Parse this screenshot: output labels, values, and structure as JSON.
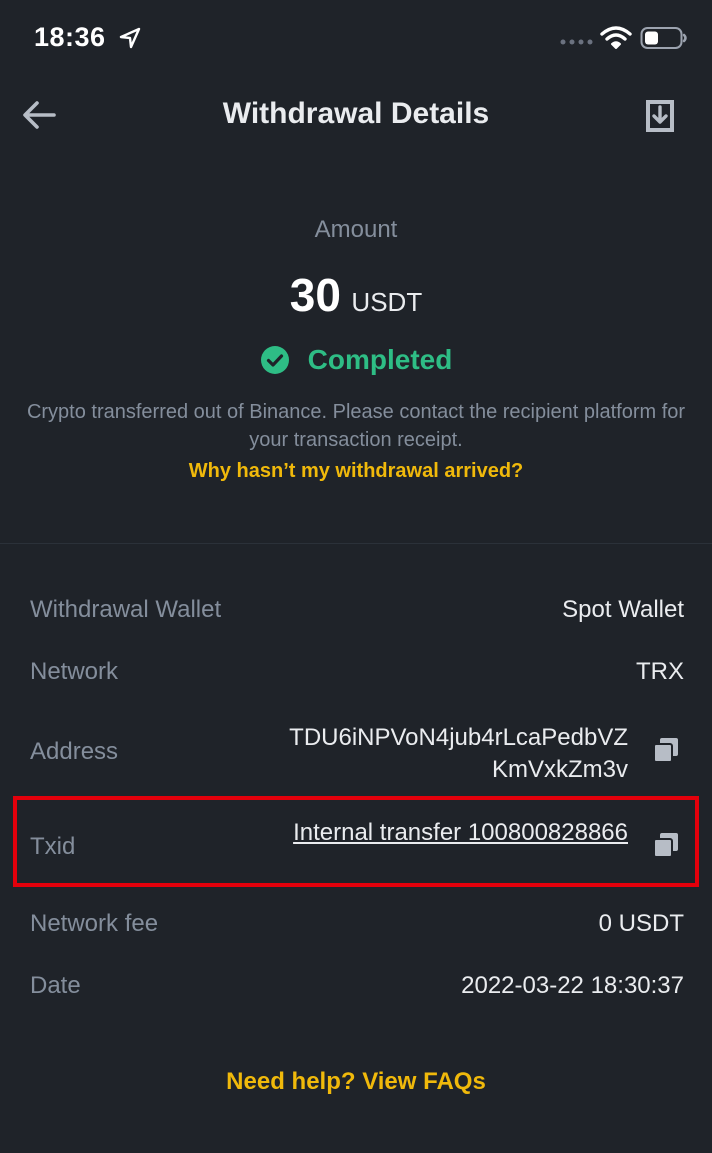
{
  "status_bar": {
    "time": "18:36",
    "icons": [
      "location-arrow-icon",
      "signal-icon",
      "wifi-icon",
      "battery-icon"
    ]
  },
  "header": {
    "title": "Withdrawal Details",
    "back_icon": "arrow-left-icon",
    "download_icon": "download-icon"
  },
  "summary": {
    "amount_label": "Amount",
    "amount_value": "30",
    "amount_unit": "USDT",
    "status": "Completed",
    "status_icon": "check-circle-icon",
    "description": "Crypto transferred out of Binance. Please contact the recipient platform for your transaction receipt.",
    "help_link": "Why hasn’t my withdrawal arrived?"
  },
  "details": {
    "withdrawal_wallet": {
      "label": "Withdrawal Wallet",
      "value": "Spot Wallet"
    },
    "network": {
      "label": "Network",
      "value": "TRX"
    },
    "address": {
      "label": "Address",
      "value": "TDU6iNPVoN4jub4rLcaPedbVZKmVxkZm3v",
      "icon": "copy-icon"
    },
    "txid": {
      "label": "Txid",
      "value": "Internal transfer 100800828866",
      "icon": "copy-icon"
    },
    "network_fee": {
      "label": "Network fee",
      "value": "0 USDT"
    },
    "date": {
      "label": "Date",
      "value": "2022-03-22 18:30:37"
    }
  },
  "footer": {
    "faq_link": "Need help? View FAQs"
  },
  "colors": {
    "background": "#1f2329",
    "accent": "#f0b90b",
    "success": "#2ebd85",
    "muted": "#848e9c",
    "highlight": "#e3000b"
  }
}
